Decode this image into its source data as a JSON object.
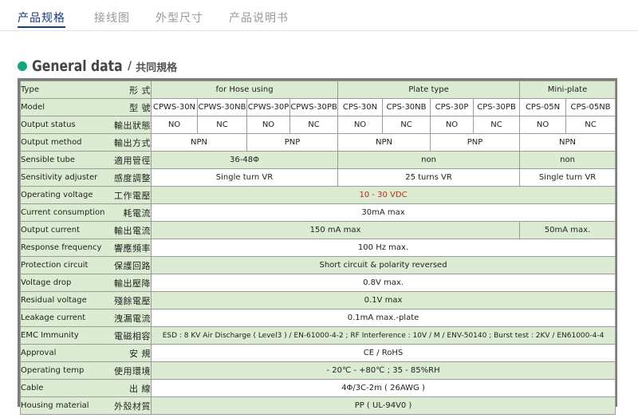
{
  "tabs": [
    {
      "label": "产品规格",
      "active": true
    },
    {
      "label": "接线图",
      "active": false
    },
    {
      "label": "外型尺寸",
      "active": false
    },
    {
      "label": "产品说明书",
      "active": false
    }
  ],
  "heading": {
    "en": "General data",
    "sep": "/",
    "zh": "共同規格"
  },
  "colors": {
    "accent": "#1a3d7c",
    "dot": "#16a47c",
    "cell_green": "#dcecd2",
    "highlight_red": "#c0281e"
  },
  "rows": {
    "type": {
      "en": "Type",
      "zh": "形 式",
      "groups": [
        "for Hose using",
        "Plate type",
        "Mini-plate"
      ]
    },
    "model": {
      "en": "Model",
      "zh": "型 號",
      "models": [
        "CPWS-30N",
        "CPWS-30NB",
        "CPWS-30P",
        "CPWS-30PB",
        "CPS-30N",
        "CPS-30NB",
        "CPS-30P",
        "CPS-30PB",
        "CPS-05N",
        "CPS-05NB"
      ]
    },
    "output_status": {
      "en": "Output status",
      "zh": "輸出狀態",
      "values": [
        "NO",
        "NC",
        "NO",
        "NC",
        "NO",
        "NC",
        "NO",
        "NC",
        "NO",
        "NC"
      ]
    },
    "output_method": {
      "en": "Output method",
      "zh": "輸出方式",
      "values": [
        "NPN",
        "PNP",
        "NPN",
        "PNP",
        "NPN"
      ]
    },
    "sensible_tube": {
      "en": "Sensible tube",
      "zh": "適用管徑",
      "values": [
        "36-48Φ",
        "non",
        "non"
      ]
    },
    "sensitivity": {
      "en": "Sensitivity adjuster",
      "zh": "感度調整",
      "values": [
        "Single turn VR",
        "25 turns VR",
        "Single turn VR"
      ]
    },
    "operating_voltage": {
      "en": "Operating voltage",
      "zh": "工作電壓",
      "value": "10 - 30 VDC"
    },
    "current_consumption": {
      "en": "Current consumption",
      "zh": "耗電流",
      "value": "30mA max"
    },
    "output_current": {
      "en": "Output current",
      "zh": "輸出電流",
      "values": [
        "150 mA max",
        "50mA max."
      ]
    },
    "response_frequency": {
      "en": "Response frequency",
      "zh": "響應頻率",
      "value": "100 Hz max."
    },
    "protection_circuit": {
      "en": "Protection circuit",
      "zh": "保護回路",
      "value": "Short circuit & polarity reversed"
    },
    "voltage_drop": {
      "en": "Voltage drop",
      "zh": "輸出壓降",
      "value": "0.8V max."
    },
    "residual_voltage": {
      "en": "Residual voltage",
      "zh": "殘餘電壓",
      "value": "0.1V max"
    },
    "leakage_current": {
      "en": "Leakage current",
      "zh": "洩漏電流",
      "value": "0.1mA max.-plate"
    },
    "emc_immunity": {
      "en": "EMC Immunity",
      "zh": "電磁相容",
      "value": "ESD : 8 KV Air Discharge ( Level3 ) / EN-61000-4-2 ; RF Interference : 10V / M / ENV-50140 ; Burst test : 2KV / EN61000-4-4"
    },
    "approval": {
      "en": "Approval",
      "zh": "安 規",
      "value": "CE / RoHS"
    },
    "operating_temp": {
      "en": "Operating temp",
      "zh": "使用環境",
      "value": "- 20℃ - +80℃ ; 35 - 85%RH"
    },
    "cable": {
      "en": "Cable",
      "zh": "出 線",
      "value": "4Φ/3C-2m ( 26AWG )"
    },
    "housing_material": {
      "en": "Housing material",
      "zh": "外殼材質",
      "value": "PP ( UL-94V0 )"
    }
  }
}
